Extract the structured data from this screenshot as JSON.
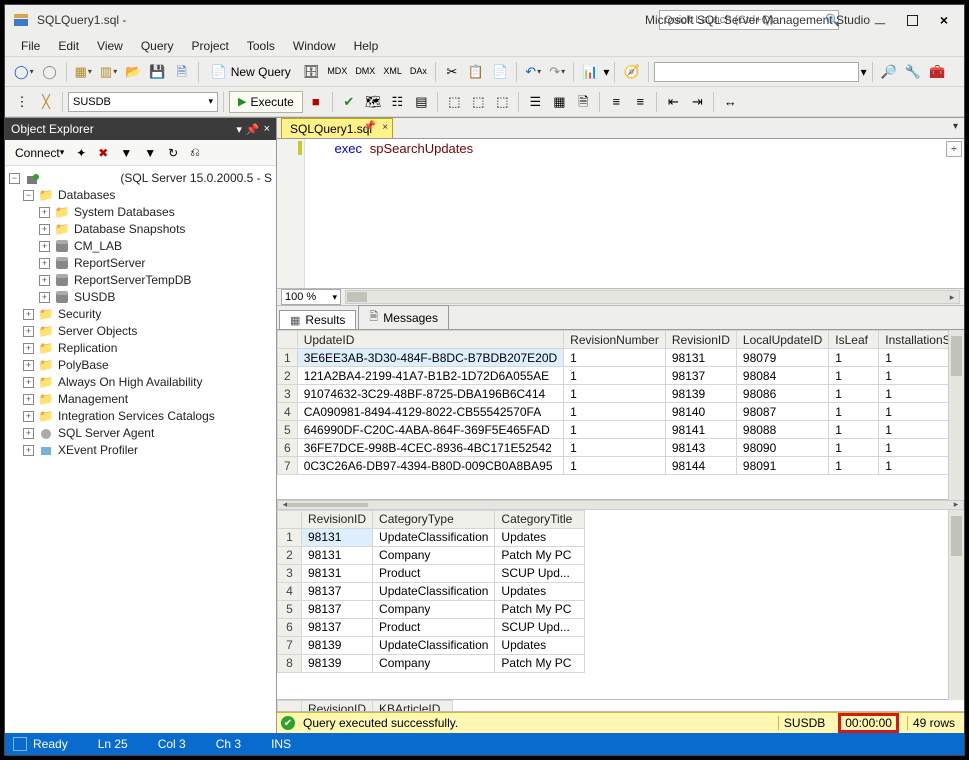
{
  "title": {
    "file": "SQLQuery1.sql -",
    "app": "Microsoft SQL Server Management Studio",
    "quick_placeholder": "Quick Launch (Ctrl+Q)"
  },
  "menus": [
    "File",
    "Edit",
    "View",
    "Query",
    "Project",
    "Tools",
    "Window",
    "Help"
  ],
  "toolbar1": {
    "newquery": "New Query"
  },
  "toolbar2": {
    "db": "SUSDB",
    "execute": "Execute"
  },
  "oex": {
    "title": "Object Explorer",
    "connect": "Connect",
    "server_suffix": "(SQL Server 15.0.2000.5 - S",
    "nodes": {
      "databases": "Databases",
      "sysdb": "System Databases",
      "snapshots": "Database Snapshots",
      "cmlab": "CM_LAB",
      "reportserver": "ReportServer",
      "reportservertemp": "ReportServerTempDB",
      "susdb": "SUSDB",
      "security": "Security",
      "serverobj": "Server Objects",
      "replication": "Replication",
      "polybase": "PolyBase",
      "alwayson": "Always On High Availability",
      "management": "Management",
      "isc": "Integration Services Catalogs",
      "agent": "SQL Server Agent",
      "xevent": "XEvent Profiler"
    }
  },
  "tabs": {
    "sql": "SQLQuery1.sql"
  },
  "editor": {
    "kw": "exec",
    "sp": "spSearchUpdates",
    "zoom": "100 %"
  },
  "results_tabs": {
    "results": "Results",
    "messages": "Messages"
  },
  "grid1": {
    "cols": [
      "UpdateID",
      "RevisionNumber",
      "RevisionID",
      "LocalUpdateID",
      "IsLeaf",
      "InstallationSuppo"
    ],
    "rows": [
      [
        "3E6EE3AB-3D30-484F-B8DC-B7BDB207E20D",
        "1",
        "98131",
        "98079",
        "1",
        "1"
      ],
      [
        "121A2BA4-2199-41A7-B1B2-1D72D6A055AE",
        "1",
        "98137",
        "98084",
        "1",
        "1"
      ],
      [
        "91074632-3C29-48BF-8725-DBA196B6C414",
        "1",
        "98139",
        "98086",
        "1",
        "1"
      ],
      [
        "CA090981-8494-4129-8022-CB55542570FA",
        "1",
        "98140",
        "98087",
        "1",
        "1"
      ],
      [
        "646990DF-C20C-4ABA-864F-369F5E465FAD",
        "1",
        "98141",
        "98088",
        "1",
        "1"
      ],
      [
        "36FE7DCE-998B-4CEC-8936-4BC171E52542",
        "1",
        "98143",
        "98090",
        "1",
        "1"
      ],
      [
        "0C3C26A6-DB97-4394-B80D-009CB0A8BA95",
        "1",
        "98144",
        "98091",
        "1",
        "1"
      ]
    ]
  },
  "grid2": {
    "cols": [
      "RevisionID",
      "CategoryType",
      "CategoryTitle"
    ],
    "rows": [
      [
        "98131",
        "UpdateClassification",
        "Updates"
      ],
      [
        "98131",
        "Company",
        "Patch My PC"
      ],
      [
        "98131",
        "Product",
        "SCUP Upd..."
      ],
      [
        "98137",
        "UpdateClassification",
        "Updates"
      ],
      [
        "98137",
        "Company",
        "Patch My PC"
      ],
      [
        "98137",
        "Product",
        "SCUP Upd..."
      ],
      [
        "98139",
        "UpdateClassification",
        "Updates"
      ],
      [
        "98139",
        "Company",
        "Patch My PC"
      ]
    ]
  },
  "grid3": {
    "cols": [
      "RevisionID",
      "KBArticleID"
    ]
  },
  "qstat": {
    "msg": "Query executed successfully.",
    "db": "SUSDB",
    "time": "00:00:00",
    "rows": "49 rows"
  },
  "bstat": {
    "ready": "Ready",
    "ln": "Ln 25",
    "col": "Col 3",
    "ch": "Ch 3",
    "ins": "INS"
  }
}
